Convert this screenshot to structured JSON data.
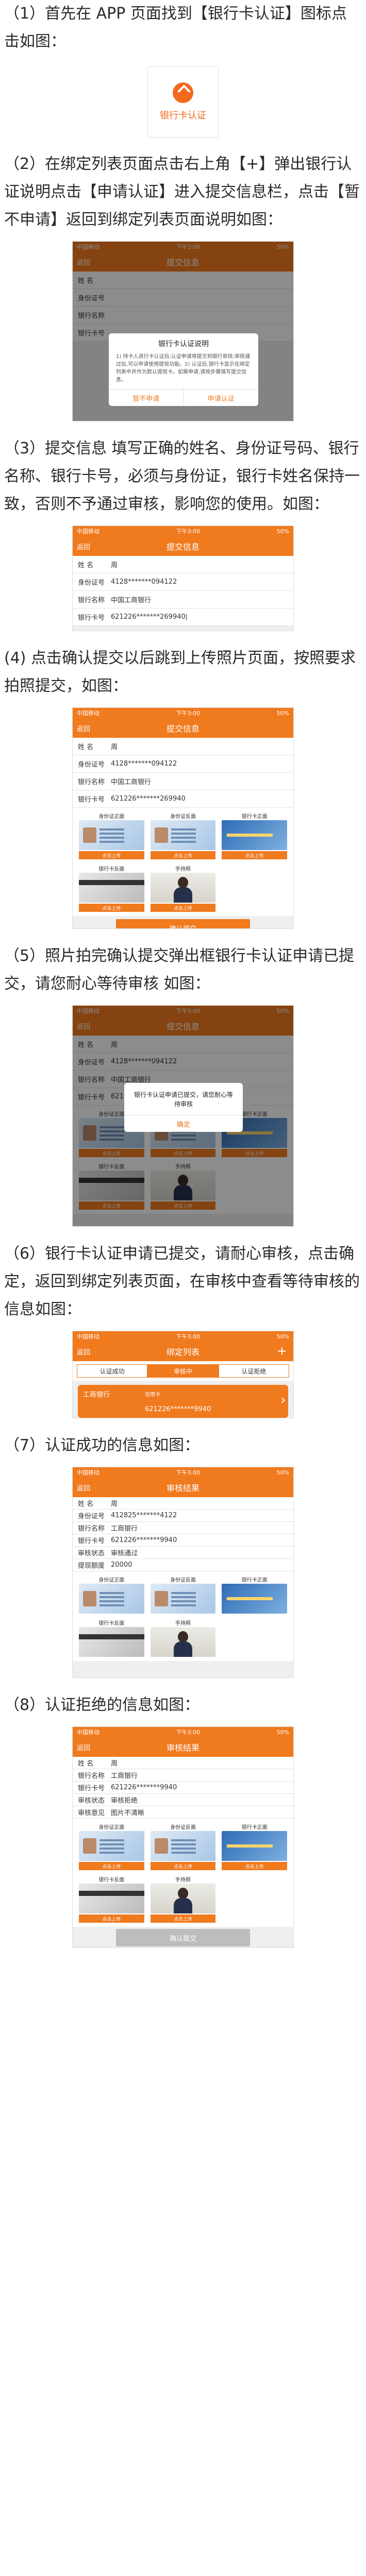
{
  "steps": {
    "s1": "（1）首先在 APP 页面找到【银行卡认证】图标点击如图：",
    "s2": "（2）在绑定列表页面点击右上角【+】弹出银行认证说明点击【申请认证】进入提交信息栏，点击【暂不申请】返回到绑定列表页面说明如图：",
    "s3": "（3）提交信息 填写正确的姓名、身份证号码、银行名称、银行卡号，必须与身份证，银行卡姓名保持一致，否则不予通过审核，影响您的使用。如图：",
    "s4": "(4) 点击确认提交以后跳到上传照片页面，按照要求拍照提交，如图：",
    "s5": "（5）照片拍完确认提交弹出框银行卡认证申请已提交，请您耐心等待审核 如图：",
    "s6": "（6）银行卡认证申请已提交，请耐心审核，点击确定，返回到绑定列表页面，在审核中查看等待审核的信息如图：",
    "s7": "（7）认证成功的信息如图：",
    "s8": "（8）认证拒绝的信息如图："
  },
  "icon": {
    "label": "银行卡认证"
  },
  "status": {
    "carrier": "中国移动",
    "time": "下午3:00",
    "battery": "50%"
  },
  "nav": {
    "back": "返回",
    "submit_title": "提交信息",
    "bind_title": "绑定列表",
    "result_title": "审核结果",
    "plus": "+"
  },
  "fields": {
    "name": "姓 名",
    "id": "身份证号",
    "bank": "银行名称",
    "card": "银行卡号",
    "status": "审核状态",
    "time": "提现额度",
    "reason": "审核意见"
  },
  "values": {
    "name": "周",
    "id": "4128*******094122",
    "bank": "中国工商银行",
    "card": "621226*******269940",
    "id_short": "412825*******4122",
    "bank_short": "工商银行",
    "card_short": "621226*******9940",
    "ok": "审核通过",
    "limit": "20000",
    "reject": "审核拒绝",
    "reason": "图片不清晰"
  },
  "modal1": {
    "title": "银行卡认证说明",
    "body": "1) 持卡人进行卡认证后,认证申请将提交到银行审核;审核通过后,可以申请使用提现功能。2) 认证后,银行卡显示在绑定列表中并作为默认提现卡。如需申请,请按步骤填写提交信息。",
    "cancel": "暂不申请",
    "ok": "申请认证"
  },
  "modal2": {
    "body": "银行卡认证申请已提交，请您耐心等待审核",
    "ok": "确定"
  },
  "buttons": {
    "confirm": "确认提交"
  },
  "photos": {
    "id_front": "身份证正面",
    "id_back": "身份证反面",
    "card_front": "银行卡正面",
    "card_back": "银行卡反面",
    "hold": "手持照",
    "upload": "点击上传"
  },
  "tabs": [
    "认证成功",
    "审核中",
    "认证拒绝"
  ],
  "bankcard": {
    "bank": "工商银行",
    "type": "信用卡",
    "no": "621226*******9940"
  }
}
